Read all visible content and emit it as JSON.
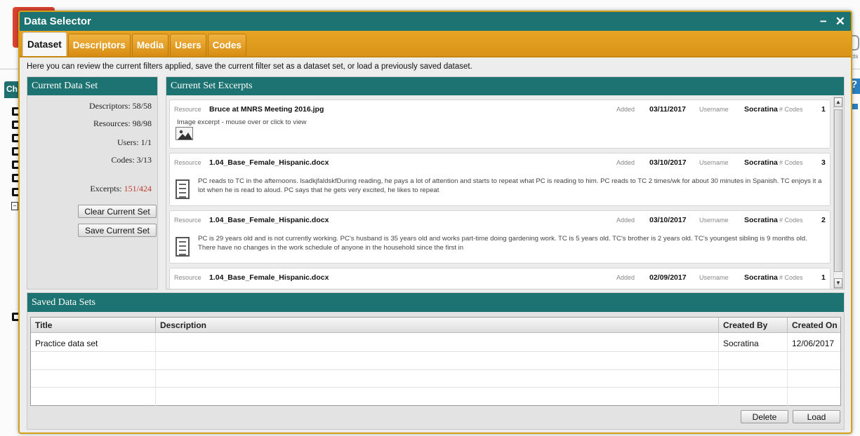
{
  "background": {
    "left_tab_label": "Ch",
    "help_icon": "?",
    "right_edge_text": "cts",
    "colors": {
      "teal": "#1d7272",
      "orange": "#e8a424",
      "red_badge": "#d9432f",
      "blue_help": "#2a7fbf"
    }
  },
  "dialog": {
    "title": "Data Selector",
    "minimize_glyph": "−",
    "close_glyph": "✕",
    "tabs": [
      "Dataset",
      "Descriptors",
      "Media",
      "Users",
      "Codes"
    ],
    "active_tab": "Dataset",
    "intro": "Here you can review the current filters applied, save the current filter set as a dataset set, or load a previously saved dataset."
  },
  "current_data_set": {
    "heading": "Current Data Set",
    "stats": [
      {
        "label": "Descriptors:",
        "value": "58/58"
      },
      {
        "label": "Resources:",
        "value": "98/98"
      },
      {
        "label": "Users:",
        "value": "1/1"
      },
      {
        "label": "Codes:",
        "value": "3/13"
      },
      {
        "label": "Excerpts:",
        "value": "151/424"
      }
    ],
    "excerpts_color": "#c0392b",
    "clear_button": "Clear Current Set",
    "save_button": "Save Current Set"
  },
  "excerpts": {
    "heading": "Current Set Excerpts",
    "labels": {
      "resource": "Resource",
      "added": "Added",
      "username": "Username",
      "codes": "# Codes"
    },
    "items": [
      {
        "resource": "Bruce at MNRS Meeting 2016.jpg",
        "added": "03/11/2017",
        "username": "Socratina",
        "codes": "1",
        "kind": "image",
        "text": "Image excerpt - mouse over or click to view"
      },
      {
        "resource": "1.04_Base_Female_Hispanic.docx",
        "added": "03/10/2017",
        "username": "Socratina",
        "codes": "3",
        "kind": "document",
        "text": "PC reads to TC in the afternoons.  lsadkjfaldskfDuring reading, he pays a lot of attention and starts to repeat what PC is reading to him.  PC reads to TC 2 times/wk for about 30 minutes in Spanish.  TC enjoys it a lot when he is read to aloud.  PC says that he gets very excited, he likes to repeat"
      },
      {
        "resource": "1.04_Base_Female_Hispanic.docx",
        "added": "03/10/2017",
        "username": "Socratina",
        "codes": "2",
        "kind": "document",
        "text": "PC is 29 years old and is not currently working.  PC's husband is 35 years old and works part-time doing gardening work.  TC is 5 years old.  TC's brother is 2 years old.  TC's youngest sibling is 9 months old.  There have no changes in the work schedule of anyone in the household since the first in"
      },
      {
        "resource": "1.04_Base_Female_Hispanic.docx",
        "added": "02/09/2017",
        "username": "Socratina",
        "codes": "1",
        "kind": "document",
        "text": ""
      }
    ]
  },
  "saved_data_sets": {
    "heading": "Saved Data Sets",
    "columns": [
      "Title",
      "Description",
      "Created By",
      "Created On"
    ],
    "rows": [
      {
        "title": "Practice data set",
        "description": "",
        "created_by": "Socratina",
        "created_on": "12/06/2017"
      }
    ],
    "delete_button": "Delete",
    "load_button": "Load"
  }
}
